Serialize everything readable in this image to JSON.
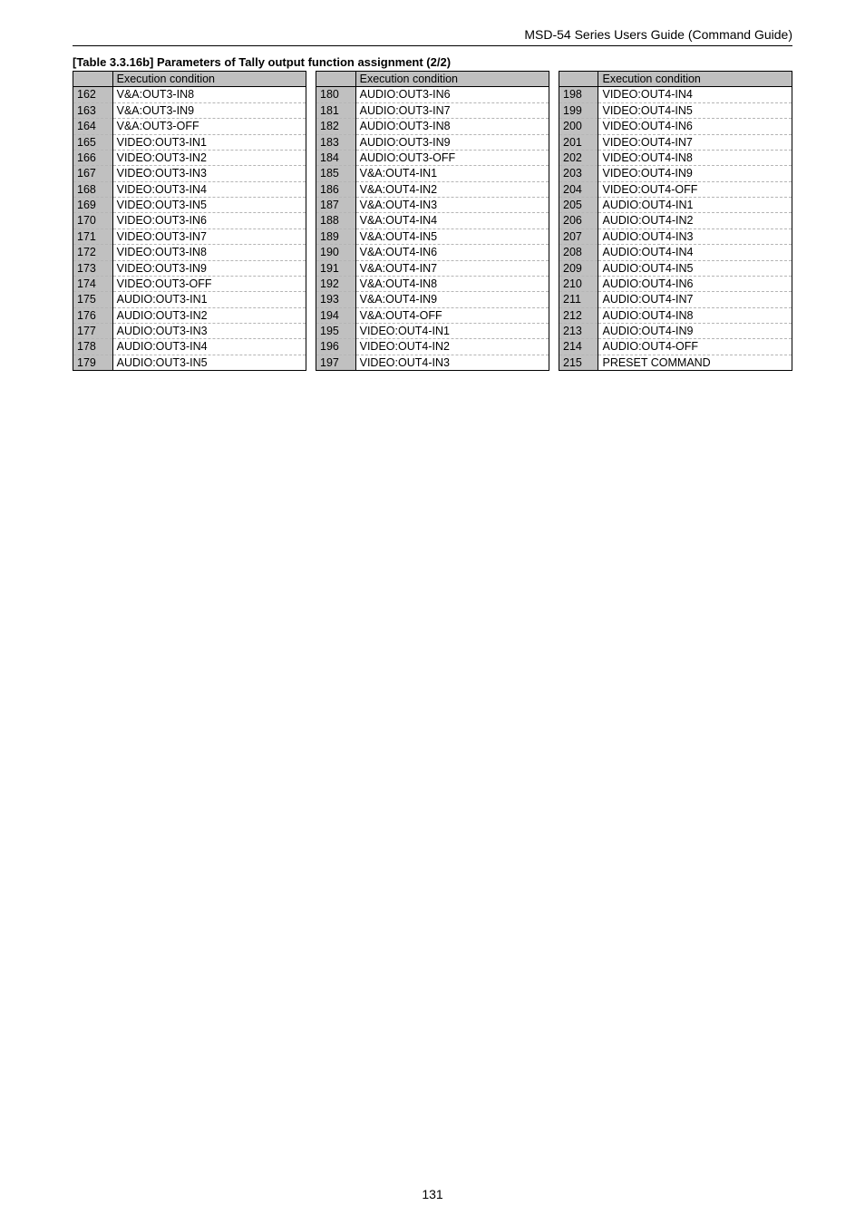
{
  "header_title": "MSD-54 Series Users Guide (Command Guide)",
  "table_caption": "[Table 3.3.16b] Parameters of Tally output function assignment (2/2)",
  "column_header": "Execution condition",
  "page_number": "131",
  "columns": [
    [
      {
        "n": "162",
        "v": "V&A:OUT3-IN8"
      },
      {
        "n": "163",
        "v": "V&A:OUT3-IN9"
      },
      {
        "n": "164",
        "v": "V&A:OUT3-OFF"
      },
      {
        "n": "165",
        "v": "VIDEO:OUT3-IN1"
      },
      {
        "n": "166",
        "v": "VIDEO:OUT3-IN2"
      },
      {
        "n": "167",
        "v": "VIDEO:OUT3-IN3"
      },
      {
        "n": "168",
        "v": "VIDEO:OUT3-IN4"
      },
      {
        "n": "169",
        "v": "VIDEO:OUT3-IN5"
      },
      {
        "n": "170",
        "v": "VIDEO:OUT3-IN6"
      },
      {
        "n": "171",
        "v": "VIDEO:OUT3-IN7"
      },
      {
        "n": "172",
        "v": "VIDEO:OUT3-IN8"
      },
      {
        "n": "173",
        "v": "VIDEO:OUT3-IN9"
      },
      {
        "n": "174",
        "v": "VIDEO:OUT3-OFF"
      },
      {
        "n": "175",
        "v": "AUDIO:OUT3-IN1"
      },
      {
        "n": "176",
        "v": "AUDIO:OUT3-IN2"
      },
      {
        "n": "177",
        "v": "AUDIO:OUT3-IN3"
      },
      {
        "n": "178",
        "v": "AUDIO:OUT3-IN4"
      },
      {
        "n": "179",
        "v": "AUDIO:OUT3-IN5"
      }
    ],
    [
      {
        "n": "180",
        "v": "AUDIO:OUT3-IN6"
      },
      {
        "n": "181",
        "v": "AUDIO:OUT3-IN7"
      },
      {
        "n": "182",
        "v": "AUDIO:OUT3-IN8"
      },
      {
        "n": "183",
        "v": "AUDIO:OUT3-IN9"
      },
      {
        "n": "184",
        "v": "AUDIO:OUT3-OFF"
      },
      {
        "n": "185",
        "v": "V&A:OUT4-IN1"
      },
      {
        "n": "186",
        "v": "V&A:OUT4-IN2"
      },
      {
        "n": "187",
        "v": "V&A:OUT4-IN3"
      },
      {
        "n": "188",
        "v": "V&A:OUT4-IN4"
      },
      {
        "n": "189",
        "v": "V&A:OUT4-IN5"
      },
      {
        "n": "190",
        "v": "V&A:OUT4-IN6"
      },
      {
        "n": "191",
        "v": "V&A:OUT4-IN7"
      },
      {
        "n": "192",
        "v": "V&A:OUT4-IN8"
      },
      {
        "n": "193",
        "v": "V&A:OUT4-IN9"
      },
      {
        "n": "194",
        "v": "V&A:OUT4-OFF"
      },
      {
        "n": "195",
        "v": "VIDEO:OUT4-IN1"
      },
      {
        "n": "196",
        "v": "VIDEO:OUT4-IN2"
      },
      {
        "n": "197",
        "v": "VIDEO:OUT4-IN3"
      }
    ],
    [
      {
        "n": "198",
        "v": "VIDEO:OUT4-IN4"
      },
      {
        "n": "199",
        "v": "VIDEO:OUT4-IN5"
      },
      {
        "n": "200",
        "v": "VIDEO:OUT4-IN6"
      },
      {
        "n": "201",
        "v": "VIDEO:OUT4-IN7"
      },
      {
        "n": "202",
        "v": "VIDEO:OUT4-IN8"
      },
      {
        "n": "203",
        "v": "VIDEO:OUT4-IN9"
      },
      {
        "n": "204",
        "v": "VIDEO:OUT4-OFF"
      },
      {
        "n": "205",
        "v": "AUDIO:OUT4-IN1"
      },
      {
        "n": "206",
        "v": "AUDIO:OUT4-IN2"
      },
      {
        "n": "207",
        "v": "AUDIO:OUT4-IN3"
      },
      {
        "n": "208",
        "v": "AUDIO:OUT4-IN4"
      },
      {
        "n": "209",
        "v": "AUDIO:OUT4-IN5"
      },
      {
        "n": "210",
        "v": "AUDIO:OUT4-IN6"
      },
      {
        "n": "211",
        "v": "AUDIO:OUT4-IN7"
      },
      {
        "n": "212",
        "v": "AUDIO:OUT4-IN8"
      },
      {
        "n": "213",
        "v": "AUDIO:OUT4-IN9"
      },
      {
        "n": "214",
        "v": "AUDIO:OUT4-OFF"
      },
      {
        "n": "215",
        "v": "PRESET COMMAND"
      }
    ]
  ]
}
